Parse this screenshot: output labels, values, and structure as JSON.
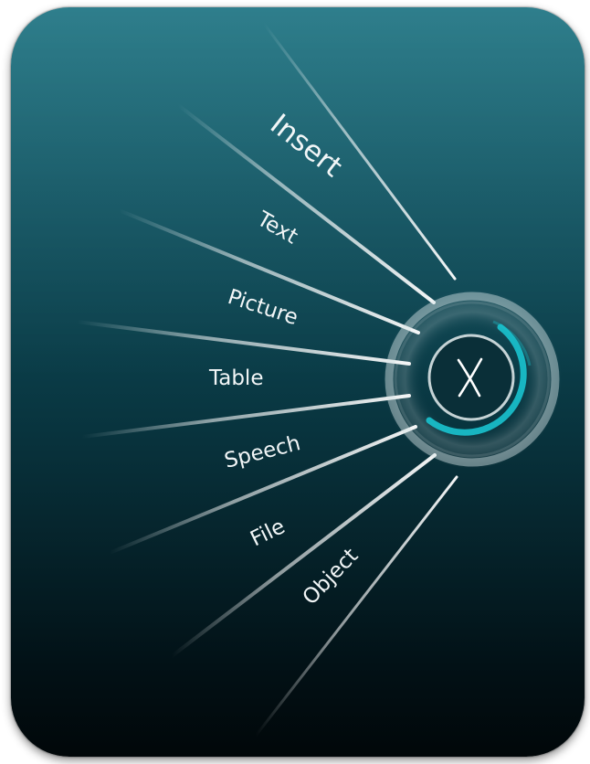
{
  "menu": {
    "title": "Insert",
    "items": [
      {
        "label": "Text"
      },
      {
        "label": "Picture"
      },
      {
        "label": "Table"
      },
      {
        "label": "Speech"
      },
      {
        "label": "File"
      },
      {
        "label": "Object"
      }
    ]
  },
  "close_button": {
    "icon": "close-icon"
  },
  "colors": {
    "panel_top": "#17707f",
    "panel_bottom": "#010709",
    "accent": "#19c3cf",
    "text": "#f2f6f7"
  }
}
